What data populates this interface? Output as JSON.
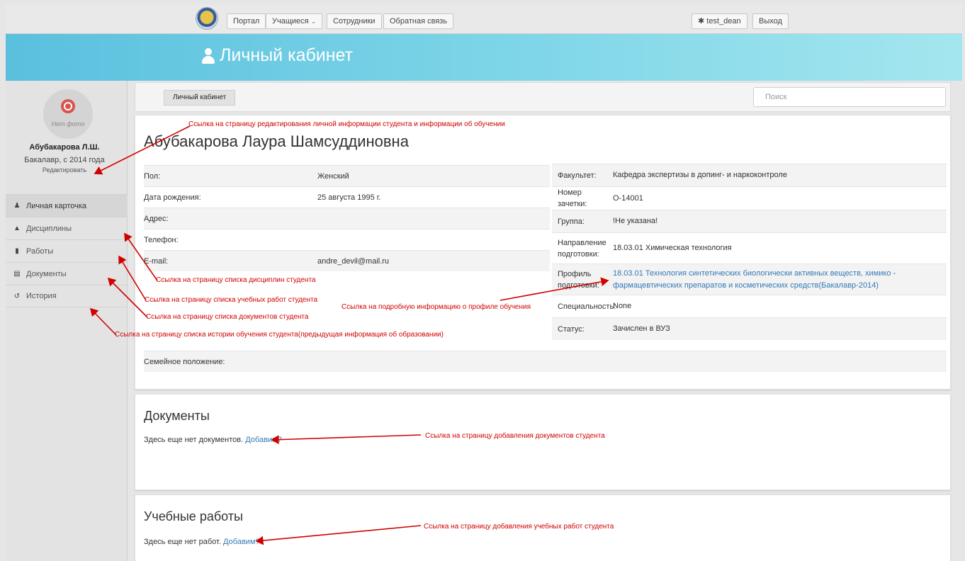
{
  "topnav": {
    "items": [
      {
        "label": "Портал"
      },
      {
        "label": "Учащиеся"
      },
      {
        "label": "Сотрудники"
      },
      {
        "label": "Обратная связь"
      }
    ],
    "user_label": "test_dean",
    "logout_label": "Выход"
  },
  "banner": {
    "title": "Личный кабинет"
  },
  "sidebar": {
    "no_photo": "Нет фото",
    "short_name": "Абубакарова Л.Ш.",
    "degree": "Бакалавр, с 2014 года",
    "edit_label": "Редактировать",
    "menu": [
      {
        "label": "Личная карточка",
        "icon": "user-icon"
      },
      {
        "label": "Дисциплины",
        "icon": "graduation-cap-icon"
      },
      {
        "label": "Работы",
        "icon": "book-icon"
      },
      {
        "label": "Документы",
        "icon": "document-icon"
      },
      {
        "label": "История",
        "icon": "history-icon"
      }
    ]
  },
  "toolbar": {
    "active_tab": "Личный кабинет",
    "search_placeholder": "Поиск"
  },
  "student": {
    "full_name": "Абубакарова Лаура Шамсуддиновна",
    "personal": [
      {
        "key": "Пол:",
        "value": "Женский"
      },
      {
        "key": "Дата рождения:",
        "value": "25 августа 1995 г."
      },
      {
        "key": "Адрес:",
        "value": ""
      },
      {
        "key": "Телефон:",
        "value": ""
      },
      {
        "key": "E-mail:",
        "value": "andre_devil@mail.ru"
      }
    ],
    "study": [
      {
        "key": "Факультет:",
        "value": "Кафедра экспертизы в допинг- и наркоконтроле"
      },
      {
        "key": "Номер зачетки:",
        "value": "О-14001"
      },
      {
        "key": "Группа:",
        "value": "!Не указана!"
      },
      {
        "key": "Направление подготовки:",
        "value": "18.03.01 Химическая технология"
      },
      {
        "key": "Профиль подготовки:",
        "value": "18.03.01 Технология синтетических биологически активных веществ, химико - фармацевтических препаратов и косметических средств(Бакалавр-2014)"
      },
      {
        "key": "Специальность:",
        "value": "None"
      },
      {
        "key": "Статус:",
        "value": "Зачислен в ВУЗ"
      }
    ],
    "family_label": "Семейное положение:"
  },
  "documents": {
    "title": "Документы",
    "empty_text": "Здесь еще нет документов.",
    "add_link": "Добавим?"
  },
  "works": {
    "title": "Учебные работы",
    "empty_text": "Здесь еще нет работ.",
    "add_link": "Добавим?"
  },
  "annotations": {
    "edit": "Ссылка на страницу редактирования личной информации студента и информации об обучении",
    "disciplines": "Ссылка на страницу списка дисциплин студента",
    "works": "Ссылка на страницу списка учебных работ студента",
    "documents": "Ссылка на страницу списка документов студента",
    "history": "Ссылка на страницу списка истории обучения студента(предыдущая информация об образовании)",
    "profile": "Ссылка на подробную информацию о профиле обучения",
    "add_documents": "Ссылка на страницу добавления документов студента",
    "add_works": "Ссылка на страницу добавления учебных работ студента"
  },
  "colors": {
    "accent": "#5ac0de",
    "link": "#337ab7",
    "annotation": "#d10000"
  }
}
